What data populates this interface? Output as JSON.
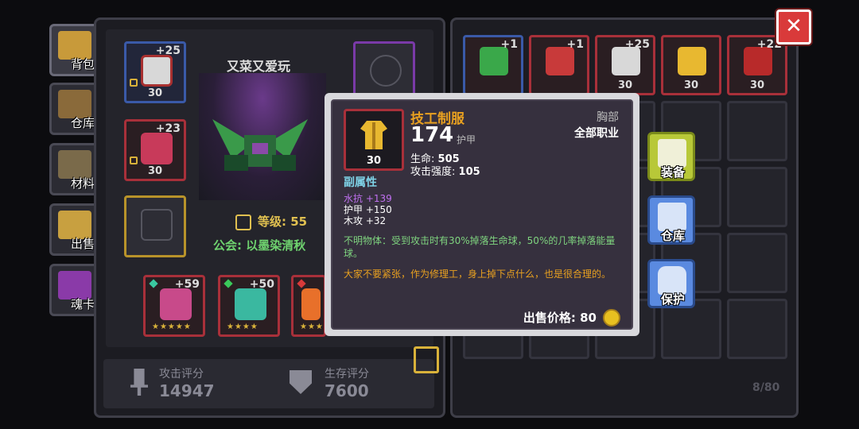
{
  "tabs": [
    {
      "label": "背包",
      "icon": "backpack-icon"
    },
    {
      "label": "仓库",
      "icon": "chest-icon"
    },
    {
      "label": "材料",
      "icon": "material-icon"
    },
    {
      "label": "出售",
      "icon": "sell-icon"
    },
    {
      "label": "魂卡",
      "icon": "soul-card-icon"
    }
  ],
  "character": {
    "name": "又菜又爱玩",
    "level_text": "等级: 55",
    "guild_text": "公会: 以墨染清秋",
    "equip_slots": [
      {
        "plus": "+25",
        "level": "30",
        "icon": "skull-helmet-icon"
      },
      {
        "plus": "+23",
        "level": "30",
        "icon": "red-cape-icon"
      },
      {
        "plus": "",
        "level": "",
        "icon": "empty-armor-slot-icon"
      },
      {
        "plus": "",
        "level": "",
        "icon": "empty-accessory-slot-icon"
      }
    ],
    "weapon_slots": [
      {
        "plus": "+59",
        "stars": "★★★★★",
        "icon": "axe-icon"
      },
      {
        "plus": "+50",
        "stars": "★★★★",
        "icon": "blade-icon"
      },
      {
        "plus": "",
        "stars": "★★★",
        "icon": "fire-weapon-icon"
      }
    ]
  },
  "scores": {
    "attack_label": "攻击评分",
    "attack_value": "14947",
    "survival_label": "生存评分",
    "survival_value": "7600"
  },
  "inventory": {
    "count_text": "8/80",
    "items": [
      {
        "plus": "+1",
        "level": "",
        "icon": "green-sword-icon"
      },
      {
        "plus": "+1",
        "level": "",
        "icon": "red-sword-icon"
      },
      {
        "plus": "+25",
        "level": "30",
        "icon": "white-red-helmet-icon"
      },
      {
        "plus": "",
        "level": "30",
        "icon": "yellow-uniform-icon"
      },
      {
        "plus": "+22",
        "level": "30",
        "icon": "red-necklace-icon"
      }
    ]
  },
  "tooltip": {
    "name": "技工制服",
    "level": "30",
    "power": "174",
    "power_label": "护甲",
    "slot": "胸部",
    "class": "全部职业",
    "stats": [
      {
        "label": "生命:",
        "value": "505"
      },
      {
        "label": "攻击强度:",
        "value": "105"
      }
    ],
    "sub_title": "副属性",
    "sub_stats": [
      {
        "text": "水抗 +139",
        "color": "purple"
      },
      {
        "text": "护甲 +150",
        "color": "white"
      },
      {
        "text": "木攻 +32",
        "color": "white"
      }
    ],
    "effect": "不明物体：受到攻击时有30%掉落生命球，50%的几率掉落能量球。",
    "flavor": "大家不要紧张，作为修理工，身上掉下点什么，也是很合理的。",
    "price_text": "出售价格: 80"
  },
  "actions": [
    {
      "label": "装备",
      "icon": "equip-shirt-icon",
      "color": "#b8c838"
    },
    {
      "label": "仓库",
      "icon": "warehouse-icon",
      "color": "#5a8ae0"
    },
    {
      "label": "保护",
      "icon": "lock-icon",
      "color": "#5a8ae0"
    }
  ],
  "close_label": "✕"
}
